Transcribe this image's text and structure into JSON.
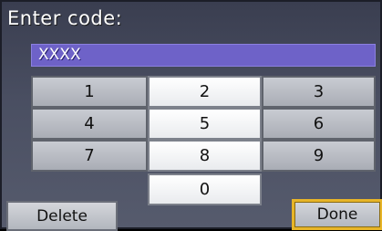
{
  "screen": {
    "title": "Enter code:",
    "code_value": "XXXX"
  },
  "keypad": {
    "keys": [
      "1",
      "2",
      "3",
      "4",
      "5",
      "6",
      "7",
      "8",
      "9",
      "0"
    ]
  },
  "actions": {
    "delete_label": "Delete",
    "done_label": "Done"
  }
}
